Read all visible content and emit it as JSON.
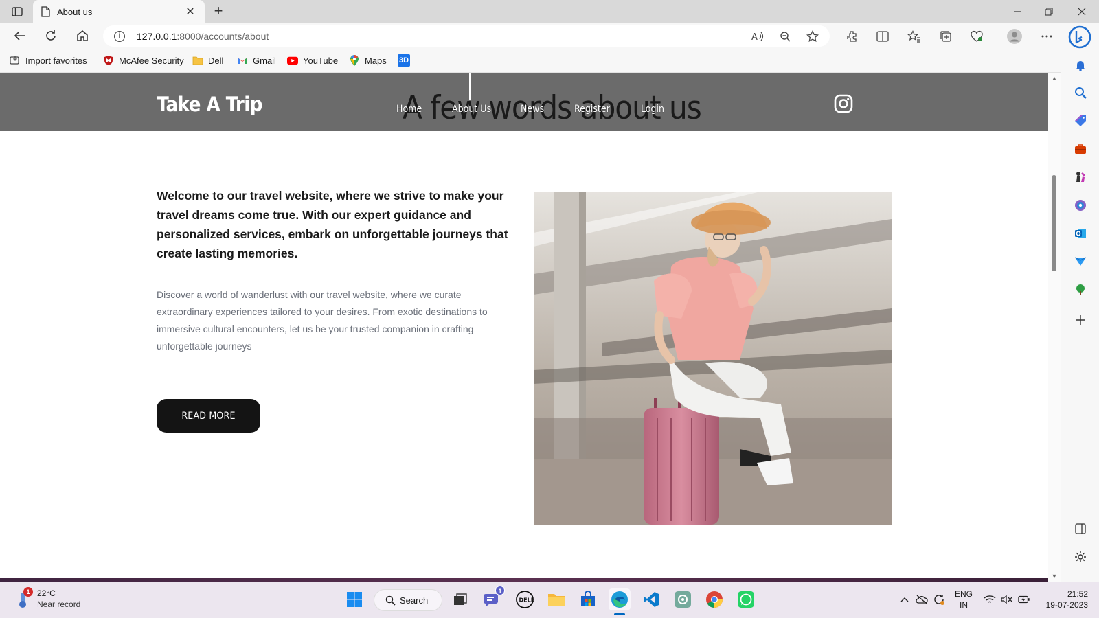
{
  "browser": {
    "tab": {
      "title": "About us"
    },
    "address": {
      "host": "127.0.0.1",
      "rest": ":8000/accounts/about"
    },
    "favorites": [
      {
        "label": "Import favorites",
        "icon": "import-icon"
      },
      {
        "label": "McAfee Security",
        "icon": "mcafee-icon"
      },
      {
        "label": "Dell",
        "icon": "folder-icon"
      },
      {
        "label": "Gmail",
        "icon": "gmail-icon"
      },
      {
        "label": "YouTube",
        "icon": "youtube-icon"
      },
      {
        "label": "Maps",
        "icon": "maps-icon"
      },
      {
        "label": "",
        "icon": "3d-app-icon",
        "badge_text": "3D"
      }
    ]
  },
  "site": {
    "logo": "Take A Trip",
    "hero_title": "A few words about us",
    "nav": [
      "Home",
      "About Us",
      "News",
      "Register",
      "Login"
    ],
    "lead": "Welcome to our travel website, where we strive to make your travel dreams come true. With our expert guidance and personalized services, embark on unforgettable journeys that create lasting memories.",
    "body": "Discover a world of wanderlust with our travel website, where we curate extraordinary experiences tailored to your desires. From exotic destinations to immersive cultural encounters, let us be your trusted companion in crafting unforgettable journeys",
    "cta": "READ MORE",
    "social_icon": "instagram-icon"
  },
  "taskbar": {
    "weather": {
      "temp": "22°C",
      "desc": "Near record",
      "alert_count": "1"
    },
    "search_label": "Search",
    "chat_badge": "1",
    "language": {
      "lang": "ENG",
      "region": "IN"
    },
    "clock": {
      "time": "21:52",
      "date": "19-07-2023"
    },
    "dell_label": "DELL"
  },
  "colors": {
    "header_bg": "#6b6b6b",
    "button_bg": "#141414",
    "accent_blue": "#0067c0"
  }
}
